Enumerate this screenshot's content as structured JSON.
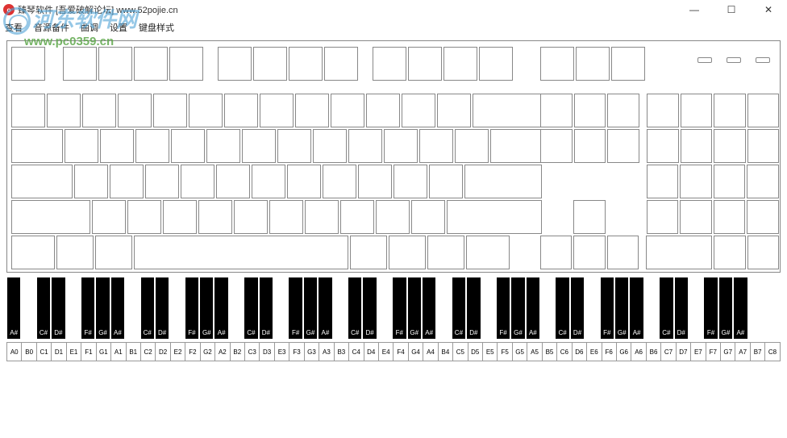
{
  "window": {
    "title": "臻琴软件 [吾爱破解论坛] www.52pojie.cn",
    "icon_letter": "o"
  },
  "winctl": {
    "min": "—",
    "max": "☐",
    "close": "✕"
  },
  "menu": [
    "查看",
    "音源备件",
    "曲调",
    "设置",
    "键盘样式"
  ],
  "watermark": {
    "text": "河东软件网",
    "url": "www.pc0359.cn"
  },
  "keyboard": {
    "row0_widths": [
      42,
      18,
      42,
      42,
      42,
      42,
      14,
      42,
      42,
      42,
      42,
      14,
      42,
      42,
      42,
      42
    ],
    "row1_main": 13,
    "row1_back": 88,
    "row2_tab": 66,
    "row2_main": 12,
    "row2_last": 66,
    "row3_caps": 78,
    "row3_main": 11,
    "row3_enter": 98,
    "row4_sh": 100,
    "row4_main": 10,
    "row4_sh2": 120,
    "row5": [
      56,
      48,
      48,
      266,
      48,
      48,
      48,
      56
    ],
    "nav_block": true
  },
  "piano": {
    "black_notes": [
      "A#",
      "",
      "C#",
      "D#",
      "",
      "F#",
      "G#",
      "A#",
      "",
      "C#",
      "D#",
      "",
      "F#",
      "G#",
      "A#",
      "",
      "C#",
      "D#",
      "",
      "F#",
      "G#",
      "A#",
      "",
      "C#",
      "D#",
      "",
      "F#",
      "G#",
      "A#",
      "",
      "C#",
      "D#",
      "",
      "F#",
      "G#",
      "A#",
      "",
      "C#",
      "D#",
      "",
      "F#",
      "G#",
      "A#",
      "",
      "C#",
      "D#",
      "",
      "F#",
      "G#",
      "A#",
      ""
    ],
    "white_notes": [
      "A0",
      "B0",
      "C1",
      "D1",
      "E1",
      "F1",
      "G1",
      "A1",
      "B1",
      "C2",
      "D2",
      "E2",
      "F2",
      "G2",
      "A2",
      "B2",
      "C3",
      "D3",
      "E3",
      "F3",
      "G3",
      "A3",
      "B3",
      "C4",
      "D4",
      "E4",
      "F4",
      "G4",
      "A4",
      "B4",
      "C5",
      "D5",
      "E5",
      "F5",
      "G5",
      "A5",
      "B5",
      "C6",
      "D6",
      "E6",
      "F6",
      "G6",
      "A6",
      "B6",
      "C7",
      "D7",
      "E7",
      "F7",
      "G7",
      "A7",
      "B7",
      "C8"
    ]
  }
}
